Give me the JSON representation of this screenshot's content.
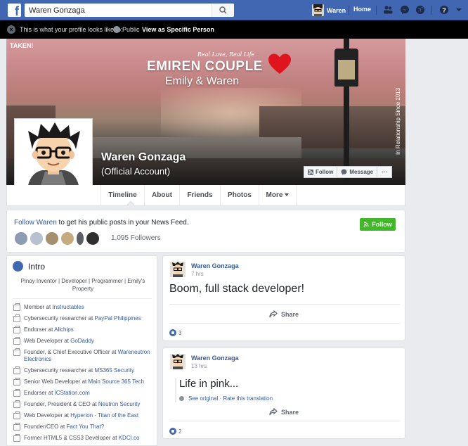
{
  "topbar": {
    "search_value": "Waren Gonzaga",
    "user_name": "Waren",
    "home_label": "Home"
  },
  "notice": {
    "text": "This is what your profile looks like to:",
    "audience": "Public",
    "view_as": "View as Specific Person"
  },
  "cover": {
    "taken": "TAKEN!",
    "tagline": "Real Love, Real Life",
    "title": "EMIREN COUPLE",
    "names": "Emily & Waren",
    "since": "In Relationship Since 2013"
  },
  "profile": {
    "name": "Waren Gonzaga",
    "subtitle": "(Official Account)",
    "follow_label": "Follow",
    "message_label": "Message",
    "more_dots": "···"
  },
  "tabs": [
    {
      "label": "Timeline"
    },
    {
      "label": "About"
    },
    {
      "label": "Friends"
    },
    {
      "label": "Photos"
    },
    {
      "label": "More"
    }
  ],
  "followbox": {
    "link": "Follow Waren",
    "text": " to get his public posts in your News Feed.",
    "button": "Follow",
    "followers": "1,095 Followers"
  },
  "intro": {
    "title": "Intro",
    "bio": "Pinoy Inventor | Developer | Programmer | Emily's Property",
    "work": [
      {
        "role": "Member at ",
        "org": "Instructables"
      },
      {
        "role": "Cybersecurity researcher at ",
        "org": "PayPal Philippines"
      },
      {
        "role": "Endorser at ",
        "org": "Allchips"
      },
      {
        "role": "Web Developer at ",
        "org": "GoDaddy"
      },
      {
        "role": "Founder, & Chief Executive Officer at ",
        "org": "Wareneutron Electronics"
      },
      {
        "role": "Cybersecurity researcher at ",
        "org": "MS365 Security"
      },
      {
        "role": "Senior Web Developer at ",
        "org": "Main Source 365 Tech"
      },
      {
        "role": "Endorser at ",
        "org": "ICStation.com"
      },
      {
        "role": "Founder, President & CEO at ",
        "org": "Neutron Security"
      },
      {
        "role": "Web Developer at ",
        "org": "Hyperion - Titan of the East"
      },
      {
        "role": "Founder/CEO at ",
        "org": "Fact You That?"
      },
      {
        "role": "Former HTML5 & CSS3 Developer at ",
        "org": "KDCI.co"
      }
    ]
  },
  "posts": [
    {
      "author": "Waren Gonzaga",
      "time": "7 hrs",
      "text": "Boom, full stack developer!",
      "share": "Share",
      "likes": "3"
    },
    {
      "author": "Waren Gonzaga",
      "time": "13 hrs",
      "text": "Life in pink...",
      "see_original": "See original",
      "sep": " · ",
      "rate": "Rate this translation",
      "share": "Share",
      "likes": "2"
    }
  ],
  "colors": {
    "brand": "#4267b2",
    "follow_green": "#42b72a",
    "link": "#365899"
  }
}
